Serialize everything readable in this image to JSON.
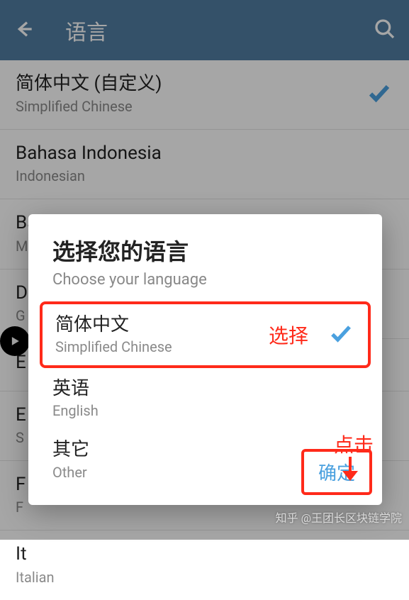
{
  "header": {
    "title": "语言"
  },
  "languages": [
    {
      "name": "简体中文 (自定义)",
      "sub": "Simplified Chinese",
      "selected": true
    },
    {
      "name": "Bahasa Indonesia",
      "sub": "Indonesian",
      "selected": false
    },
    {
      "name": "Bahasa Melayu",
      "sub": "M",
      "selected": false
    },
    {
      "name": "D",
      "sub": "G",
      "selected": false
    },
    {
      "name": "E",
      "sub": "",
      "selected": false
    },
    {
      "name": "E",
      "sub": "S",
      "selected": false
    },
    {
      "name": "F",
      "sub": "F",
      "selected": false
    },
    {
      "name": "It",
      "sub": "Italian",
      "selected": false
    }
  ],
  "dialog": {
    "title": "选择您的语言",
    "subtitle": "Choose your language",
    "options": [
      {
        "name": "简体中文",
        "sub": "Simplified Chinese",
        "selected": true
      },
      {
        "name": "英语",
        "sub": "English",
        "selected": false
      },
      {
        "name": "其它",
        "sub": "Other",
        "selected": false
      }
    ],
    "confirm_label": "确定"
  },
  "annotations": {
    "select": "选择",
    "click": "点击"
  },
  "watermark": "知乎 @王团长区块链学院"
}
